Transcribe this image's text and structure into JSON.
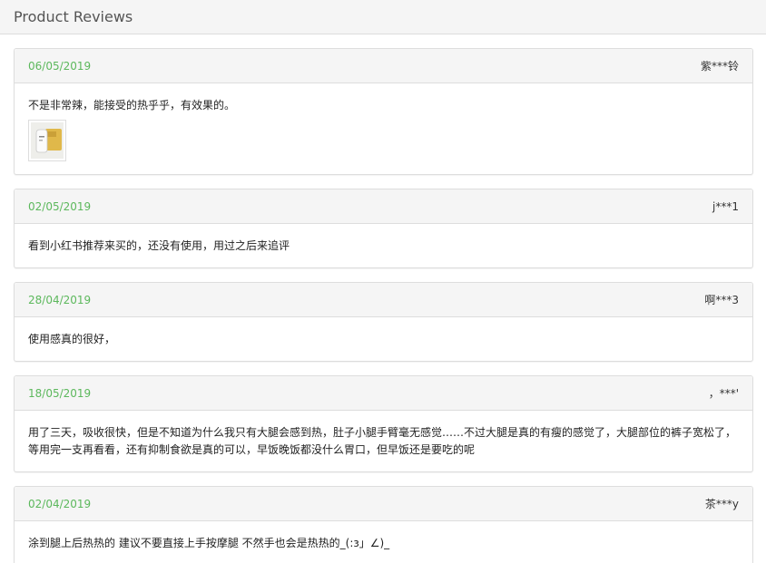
{
  "header": {
    "title": "Product Reviews"
  },
  "reviews": [
    {
      "date": "06/05/2019",
      "user": "紫***铃",
      "text": "不是非常辣，能接受的热乎乎，有效果的。",
      "has_image": true
    },
    {
      "date": "02/05/2019",
      "user": "j***1",
      "text": "看到小红书推荐来买的，还没有使用，用过之后来追评"
    },
    {
      "date": "28/04/2019",
      "user": "啊***3",
      "text": "使用感真的很好，"
    },
    {
      "date": "18/05/2019",
      "user": "，***'",
      "text": "用了三天，吸收很快，但是不知道为什么我只有大腿会感到热，肚子小腿手臂毫无感觉……不过大腿是真的有瘦的感觉了，大腿部位的裤子宽松了，等用完一支再看看，还有抑制食欲是真的可以，早饭晚饭都没什么胃口，但早饭还是要吃的呢"
    },
    {
      "date": "02/04/2019",
      "user": "茶***y",
      "text": "涂到腿上后热热的 建议不要直接上手按摩腿 不然手也会是热热的_(:з」∠)_"
    }
  ]
}
